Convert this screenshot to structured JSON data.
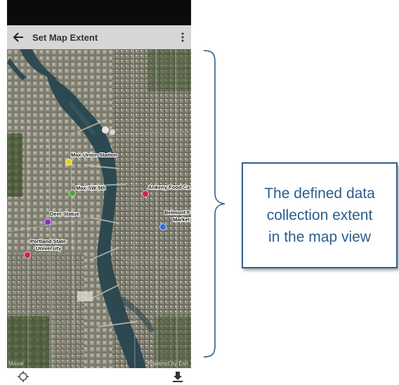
{
  "appbar": {
    "title": "Set Map Extent"
  },
  "map": {
    "labels": {
      "union": "Max-Union Station",
      "sw5": "Max-SW 5th",
      "ankeny": "Ankeny Food Ca",
      "deer": "Deer Statue",
      "belmont1": "Belmont F",
      "belmont2": "Market",
      "psu1": "Portland State",
      "psu2": "University"
    },
    "attribution_left": "Maxar",
    "attribution_right": "Powered by Esri"
  },
  "colors": {
    "union": "#e6d21a",
    "sw5": "#4aa33a",
    "ankeny": "#d11f57",
    "deer": "#8a2fc8",
    "belmont": "#2f6fe0",
    "psu": "#d11f57",
    "callout_border": "#2f5f8f",
    "callout_text": "#2b5d8e"
  },
  "callout": {
    "line1": "The defined data",
    "line2": "collection extent",
    "line3": "in the map view"
  },
  "icons": {
    "back": "arrow-left-icon",
    "more": "more-vert-icon",
    "locate": "locate-icon",
    "download": "download-icon"
  }
}
